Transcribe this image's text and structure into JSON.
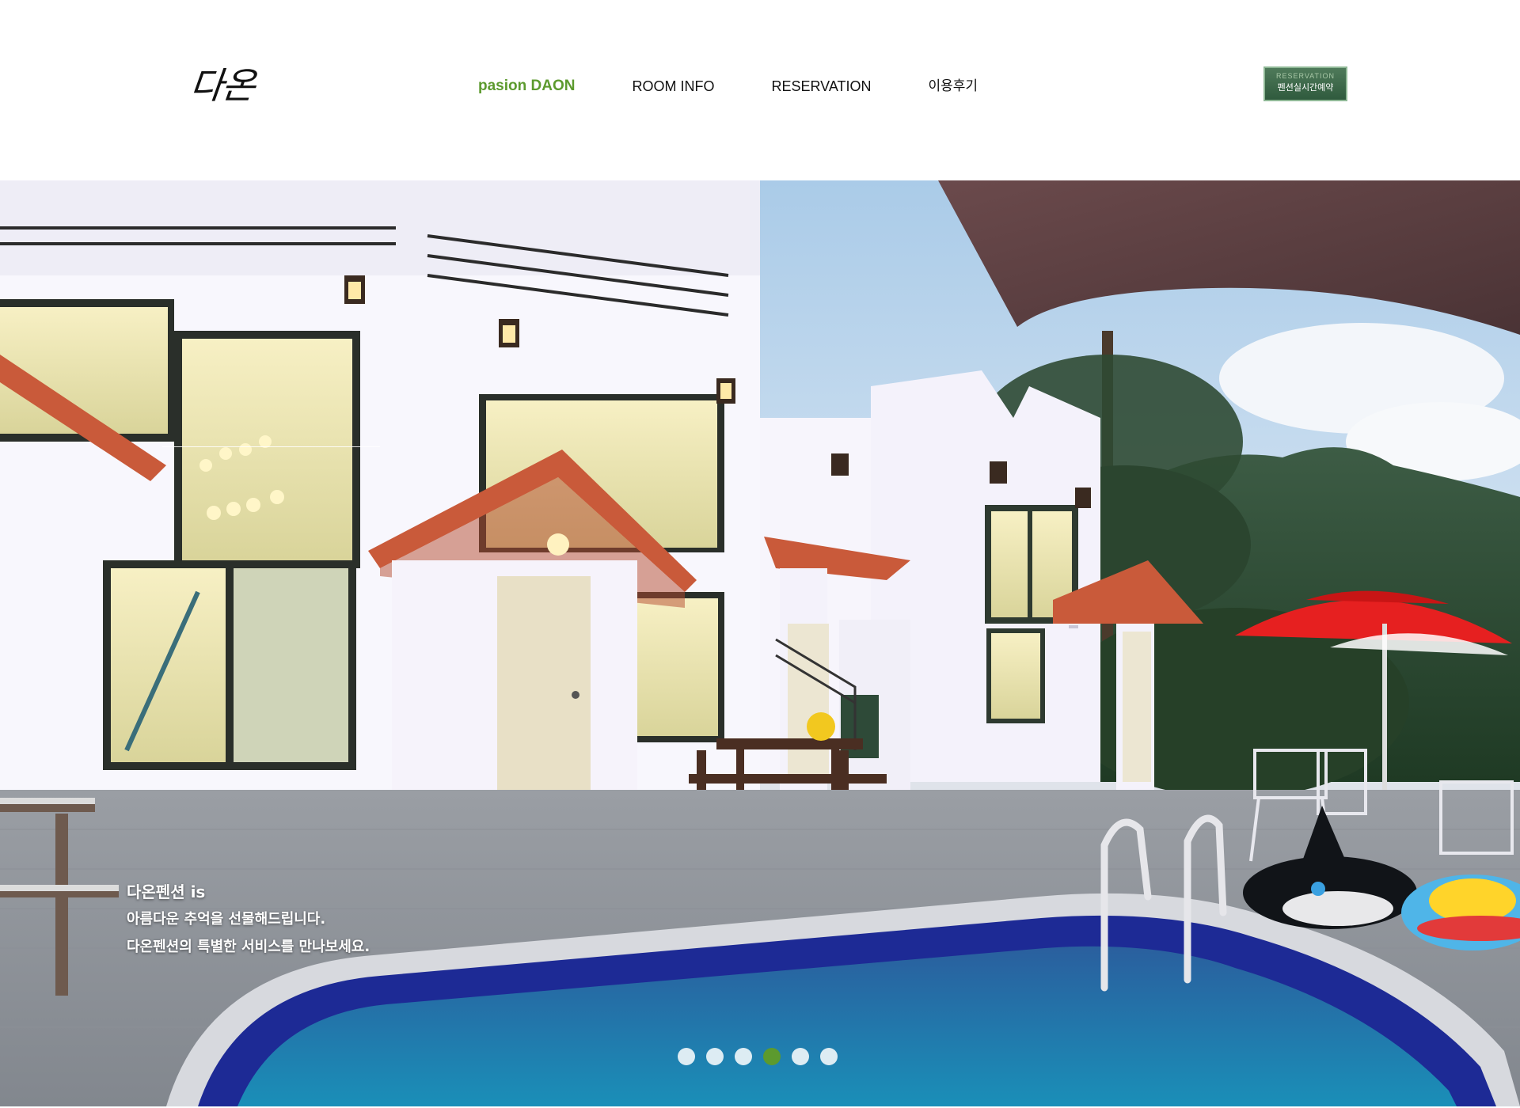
{
  "header": {
    "logo": "다온",
    "nav": [
      {
        "label": "pasion DAON"
      },
      {
        "label": "ROOM INFO"
      },
      {
        "label": "RESERVATION"
      },
      {
        "label": "이용후기"
      }
    ],
    "reservation_button": {
      "small_label": "RESERVATION",
      "label": "펜션실시간예약"
    }
  },
  "hero": {
    "line1": "다온펜션 is",
    "line2": "아름다운 추억을 선물해드립니다.",
    "line3": "다온펜션의 특별한 서비스를 만나보세요."
  },
  "slider": {
    "count": 6,
    "active_index": 3
  },
  "colors": {
    "accent": "#5c9a2e"
  }
}
